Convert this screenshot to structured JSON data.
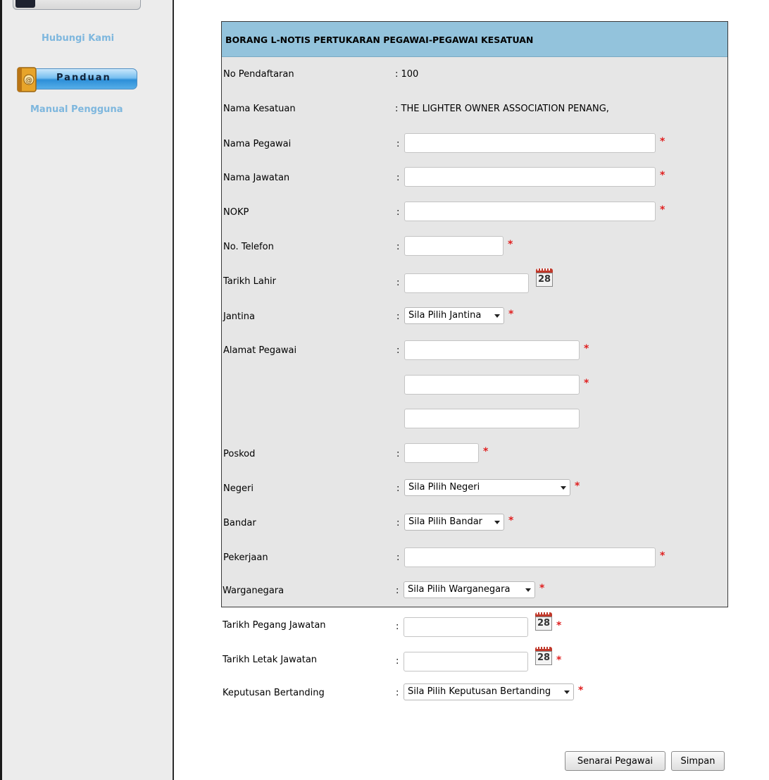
{
  "sidebar": {
    "hubungi_kami": "Hubungi Kami",
    "panduan": "Panduan",
    "manual_pengguna": "Manual Pengguna"
  },
  "form": {
    "title": "BORANG L-NOTIS PERTUKARAN PEGAWAI-PEGAWAI KESATUAN",
    "colon": ":",
    "required_mark": "*",
    "calendar_day": "28",
    "fields": {
      "no_pendaftaran": {
        "label": "No Pendaftaran",
        "value": ": 100"
      },
      "nama_kesatuan": {
        "label": "Nama Kesatuan",
        "value": ": THE LIGHTER OWNER ASSOCIATION PENANG,"
      },
      "nama_pegawai": {
        "label": "Nama Pegawai",
        "value": ""
      },
      "nama_jawatan": {
        "label": "Nama Jawatan",
        "value": ""
      },
      "nokp": {
        "label": "NOKP",
        "value": ""
      },
      "no_telefon": {
        "label": "No. Telefon",
        "value": ""
      },
      "tarikh_lahir": {
        "label": "Tarikh Lahir",
        "value": ""
      },
      "jantina": {
        "label": "Jantina",
        "selected": "Sila Pilih Jantina"
      },
      "alamat_pegawai": {
        "label": "Alamat Pegawai",
        "line1": "",
        "line2": "",
        "line3": ""
      },
      "poskod": {
        "label": "Poskod",
        "value": ""
      },
      "negeri": {
        "label": "Negeri",
        "selected": "Sila Pilih Negeri"
      },
      "bandar": {
        "label": "Bandar",
        "selected": "Sila Pilih Bandar"
      },
      "pekerjaan": {
        "label": "Pekerjaan",
        "value": ""
      },
      "warganegara": {
        "label": "Warganegara",
        "selected": "Sila Pilih Warganegara"
      },
      "tarikh_pegang_jawatan": {
        "label": "Tarikh Pegang Jawatan",
        "value": ""
      },
      "tarikh_letak_jawatan": {
        "label": "Tarikh Letak Jawatan",
        "value": ""
      },
      "keputusan_bertanding": {
        "label": "Keputusan Bertanding",
        "selected": "Sila Pilih Keputusan Bertanding"
      }
    }
  },
  "buttons": {
    "senarai_pegawai": "Senarai Pegawai",
    "simpan": "Simpan"
  },
  "colors": {
    "header_bg": "#93c3dc",
    "form_bg": "#e6e6e6",
    "sidebar_link": "#7eb7de",
    "required": "#e02020"
  }
}
